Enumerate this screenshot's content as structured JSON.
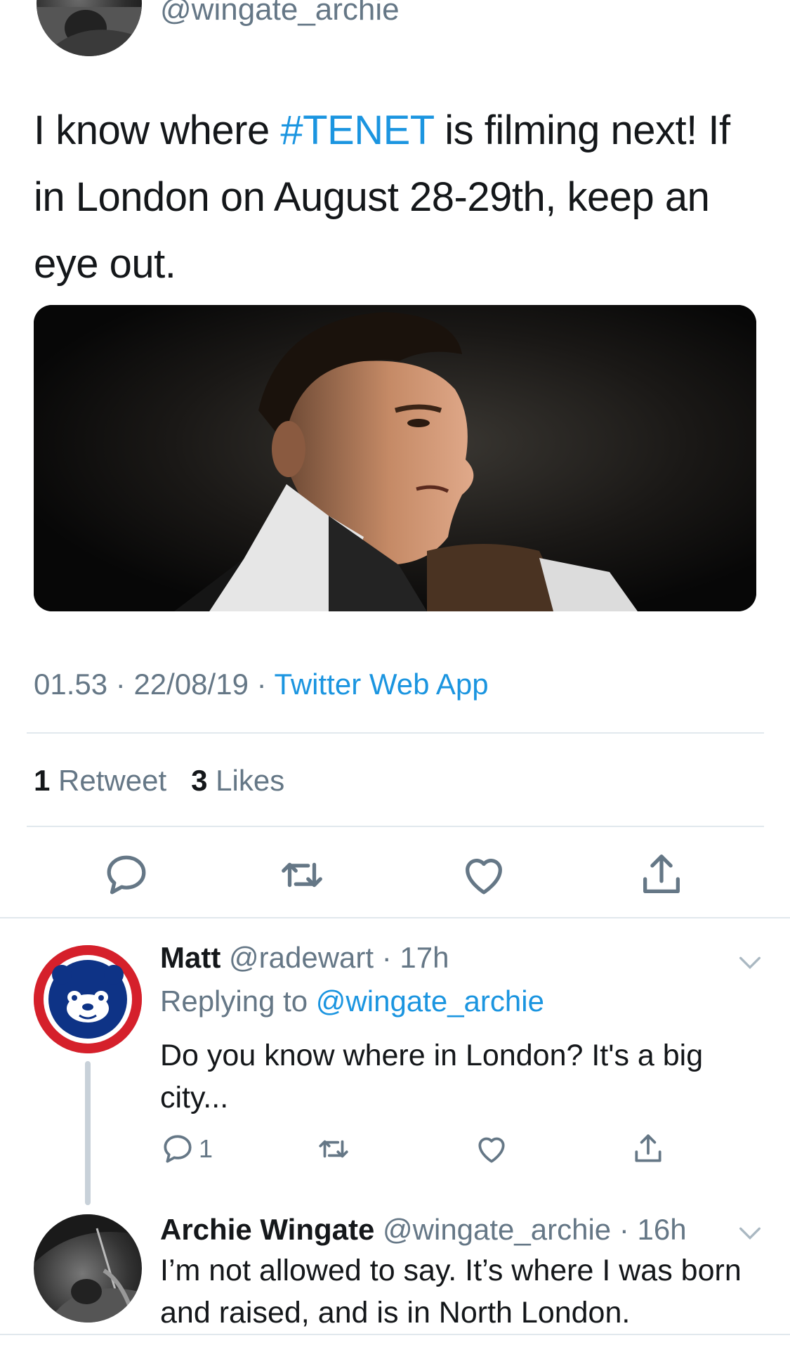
{
  "author": {
    "handle": "@wingate_archie"
  },
  "tweet": {
    "text_before_hashtag": "I know where ",
    "hashtag": "#TENET",
    "text_after_hashtag": " is filming next! If in London on August 28-29th, keep an eye out.",
    "time": "01.53",
    "date": "22/08/19",
    "source": "Twitter Web App",
    "retweet_count": "1",
    "retweet_label": "Retweet",
    "like_count": "3",
    "like_label": "Likes"
  },
  "icons": {
    "reply": "reply-icon",
    "retweet": "retweet-icon",
    "like": "heart-icon",
    "share": "share-icon",
    "more": "chevron-down-icon"
  },
  "replies": [
    {
      "name": "Matt",
      "handle": "@radewart",
      "time": "17h",
      "replying_prefix": "Replying to ",
      "replying_to": "@wingate_archie",
      "text": "Do you know where in London?  It's a big city...",
      "reply_count": "1"
    },
    {
      "name": "Archie Wingate",
      "handle": "@wingate_archie",
      "time": "16h",
      "text": "I’m not allowed to say. It’s where I was born and raised, and is in North London."
    }
  ],
  "colors": {
    "link": "#1b95e0",
    "secondary_text": "#657786",
    "divider": "#e1e8ed",
    "cubs_red": "#d5202b",
    "cubs_blue": "#0e3386"
  }
}
